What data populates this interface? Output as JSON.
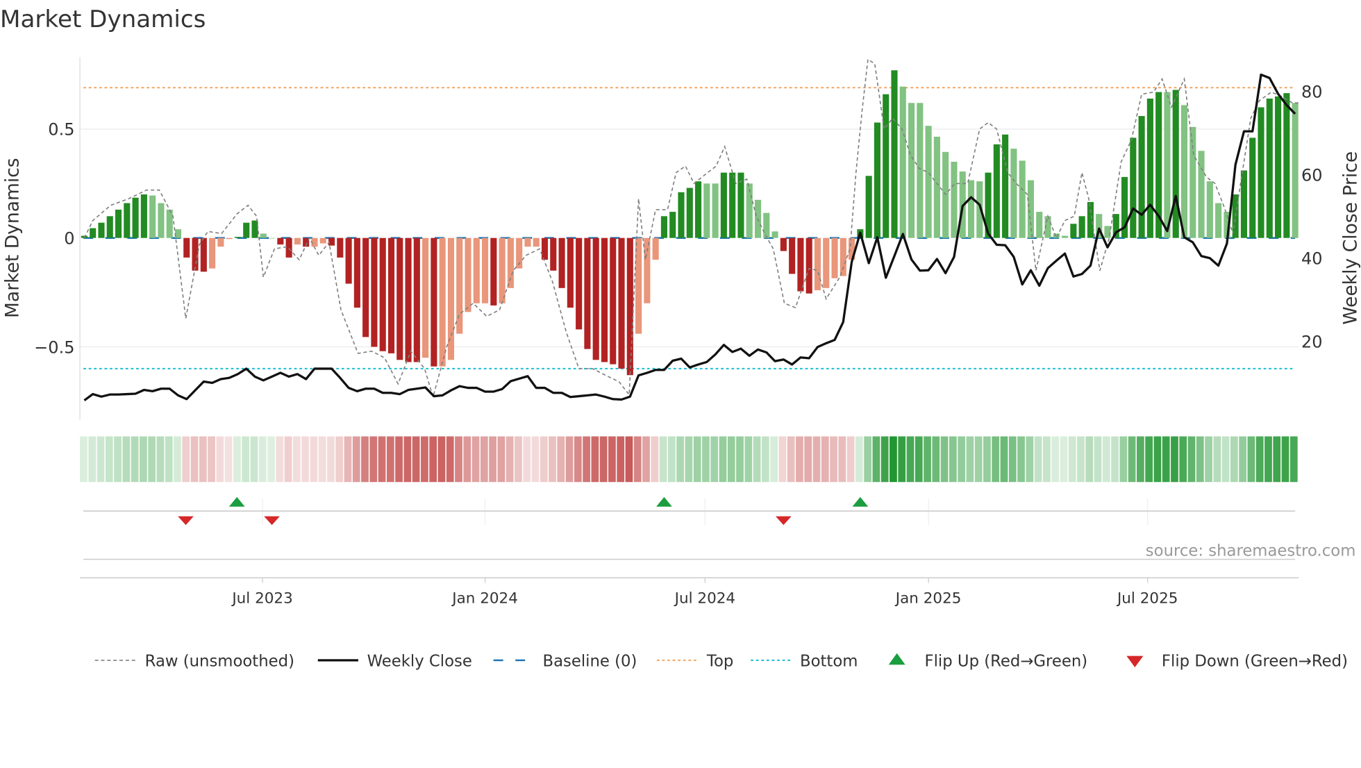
{
  "chart_data": {
    "type": "bar",
    "title": "Market Dynamics",
    "ylabel": "Market Dynamics",
    "y2label": "Weekly Close Price",
    "ylim": [
      -0.78,
      0.82
    ],
    "y2lim": [
      1,
      88
    ],
    "yticks": [
      {
        "v": 0.5,
        "label": "0.5"
      },
      {
        "v": 0,
        "label": "0"
      },
      {
        "v": -0.5,
        "label": "−0.5"
      }
    ],
    "y2ticks": [
      {
        "v": 80,
        "label": "80"
      },
      {
        "v": 60,
        "label": "60"
      },
      {
        "v": 40,
        "label": "40"
      },
      {
        "v": 20,
        "label": "20"
      }
    ],
    "x_unit": "week index",
    "xticks": [
      {
        "w": 20.9,
        "label": "Jul 2023"
      },
      {
        "w": 47,
        "label": "Jan 2024"
      },
      {
        "w": 72.8,
        "label": "Jul 2024"
      },
      {
        "w": 99,
        "label": "Jan 2025"
      },
      {
        "w": 124.7,
        "label": "Jul 2025"
      }
    ],
    "levels": {
      "top": 0.69,
      "bottom": -0.6,
      "baseline": 0
    },
    "colors": {
      "strong_up": "#228b22",
      "weak_up": "#82c282",
      "strong_down": "#b22222",
      "weak_down": "#e9967a",
      "baseline": "#1f77b4",
      "top": "#f4a460",
      "bottom": "#17becf",
      "close": "#111111",
      "raw": "#808080",
      "flip_up": "#1a9e3f",
      "flip_down": "#d62728"
    },
    "bars": [
      [
        0.01,
        1
      ],
      [
        0.045,
        1
      ],
      [
        0.07,
        1
      ],
      [
        0.1,
        1
      ],
      [
        0.13,
        1
      ],
      [
        0.16,
        1
      ],
      [
        0.185,
        1
      ],
      [
        0.2,
        1
      ],
      [
        0.195,
        0
      ],
      [
        0.16,
        0
      ],
      [
        0.13,
        0
      ],
      [
        0.04,
        0
      ],
      [
        -0.09,
        1
      ],
      [
        -0.15,
        1
      ],
      [
        -0.155,
        1
      ],
      [
        -0.14,
        0
      ],
      [
        -0.04,
        0
      ],
      [
        -0.005,
        0
      ],
      [
        0.005,
        1
      ],
      [
        0.07,
        1
      ],
      [
        0.08,
        1
      ],
      [
        0.02,
        0
      ],
      [
        0,
        0
      ],
      [
        -0.03,
        1
      ],
      [
        -0.09,
        1
      ],
      [
        -0.03,
        0
      ],
      [
        -0.04,
        1
      ],
      [
        -0.04,
        0
      ],
      [
        -0.025,
        0
      ],
      [
        -0.035,
        1
      ],
      [
        -0.09,
        1
      ],
      [
        -0.21,
        1
      ],
      [
        -0.32,
        1
      ],
      [
        -0.455,
        1
      ],
      [
        -0.5,
        1
      ],
      [
        -0.52,
        1
      ],
      [
        -0.53,
        1
      ],
      [
        -0.56,
        1
      ],
      [
        -0.57,
        1
      ],
      [
        -0.57,
        1
      ],
      [
        -0.55,
        0
      ],
      [
        -0.59,
        1
      ],
      [
        -0.59,
        0
      ],
      [
        -0.56,
        0
      ],
      [
        -0.44,
        0
      ],
      [
        -0.34,
        0
      ],
      [
        -0.3,
        0
      ],
      [
        -0.3,
        0
      ],
      [
        -0.31,
        1
      ],
      [
        -0.3,
        0
      ],
      [
        -0.23,
        0
      ],
      [
        -0.14,
        0
      ],
      [
        -0.04,
        0
      ],
      [
        -0.04,
        0
      ],
      [
        -0.1,
        1
      ],
      [
        -0.15,
        1
      ],
      [
        -0.23,
        1
      ],
      [
        -0.32,
        1
      ],
      [
        -0.42,
        1
      ],
      [
        -0.51,
        1
      ],
      [
        -0.56,
        1
      ],
      [
        -0.57,
        1
      ],
      [
        -0.58,
        1
      ],
      [
        -0.6,
        1
      ],
      [
        -0.63,
        1
      ],
      [
        -0.44,
        0
      ],
      [
        -0.3,
        0
      ],
      [
        -0.1,
        0
      ],
      [
        0.1,
        1
      ],
      [
        0.12,
        1
      ],
      [
        0.21,
        1
      ],
      [
        0.23,
        1
      ],
      [
        0.26,
        1
      ],
      [
        0.25,
        0
      ],
      [
        0.25,
        0
      ],
      [
        0.3,
        1
      ],
      [
        0.3,
        1
      ],
      [
        0.3,
        1
      ],
      [
        0.25,
        0
      ],
      [
        0.175,
        0
      ],
      [
        0.115,
        0
      ],
      [
        0.03,
        0
      ],
      [
        -0.06,
        1
      ],
      [
        -0.165,
        1
      ],
      [
        -0.245,
        1
      ],
      [
        -0.255,
        1
      ],
      [
        -0.24,
        0
      ],
      [
        -0.23,
        0
      ],
      [
        -0.185,
        0
      ],
      [
        -0.175,
        0
      ],
      [
        -0.1,
        0
      ],
      [
        0.04,
        1
      ],
      [
        0.285,
        1
      ],
      [
        0.53,
        1
      ],
      [
        0.66,
        1
      ],
      [
        0.77,
        1
      ],
      [
        0.695,
        0
      ],
      [
        0.62,
        0
      ],
      [
        0.62,
        0
      ],
      [
        0.515,
        0
      ],
      [
        0.465,
        0
      ],
      [
        0.395,
        0
      ],
      [
        0.35,
        0
      ],
      [
        0.305,
        0
      ],
      [
        0.265,
        0
      ],
      [
        0.26,
        0
      ],
      [
        0.3,
        1
      ],
      [
        0.43,
        1
      ],
      [
        0.475,
        1
      ],
      [
        0.41,
        0
      ],
      [
        0.355,
        0
      ],
      [
        0.265,
        0
      ],
      [
        0.12,
        0
      ],
      [
        0.1,
        0
      ],
      [
        0.02,
        0
      ],
      [
        0.01,
        0
      ],
      [
        0.065,
        1
      ],
      [
        0.1,
        1
      ],
      [
        0.165,
        1
      ],
      [
        0.11,
        0
      ],
      [
        0.055,
        0
      ],
      [
        0.11,
        1
      ],
      [
        0.28,
        1
      ],
      [
        0.46,
        1
      ],
      [
        0.56,
        1
      ],
      [
        0.64,
        1
      ],
      [
        0.67,
        1
      ],
      [
        0.67,
        0
      ],
      [
        0.68,
        1
      ],
      [
        0.61,
        0
      ],
      [
        0.51,
        0
      ],
      [
        0.4,
        0
      ],
      [
        0.26,
        0
      ],
      [
        0.16,
        0
      ],
      [
        0.12,
        0
      ],
      [
        0.2,
        1
      ],
      [
        0.31,
        1
      ],
      [
        0.46,
        1
      ],
      [
        0.6,
        1
      ],
      [
        0.64,
        1
      ],
      [
        0.65,
        1
      ],
      [
        0.665,
        1
      ],
      [
        0.62,
        0
      ]
    ],
    "weekly_close": [
      5.9,
      7.4,
      6.8,
      7.3,
      7.3,
      7.4,
      7.5,
      8.4,
      8.1,
      8.7,
      8.7,
      7.1,
      6.2,
      8.3,
      10.4,
      10.1,
      11,
      11.3,
      12.2,
      13.5,
      11.6,
      10.7,
      11.6,
      12.5,
      11.6,
      12.2,
      11,
      13.5,
      13.5,
      13.5,
      11.3,
      8.9,
      8.1,
      8.7,
      8.7,
      7.7,
      7.7,
      7.4,
      8.4,
      8.7,
      9,
      6.9,
      7.1,
      8.3,
      9.3,
      8.9,
      8.9,
      8,
      8,
      8.6,
      10.5,
      11.1,
      11.7,
      8.9,
      8.9,
      7.7,
      7.7,
      6.7,
      6.9,
      7.1,
      7.3,
      6.8,
      6.2,
      6.1,
      6.8,
      11.9,
      12.5,
      13.2,
      13.2,
      15.4,
      15.9,
      13.8,
      14.5,
      15.1,
      16.9,
      19.2,
      17.5,
      18.3,
      16.6,
      18.1,
      17.4,
      15.3,
      15.7,
      14.5,
      16.2,
      16,
      18.7,
      19.6,
      20.4,
      24.7,
      39.1,
      46.1,
      38.8,
      45,
      35.3,
      40.5,
      45.8,
      39.7,
      37,
      37.1,
      39.8,
      36.4,
      40.3,
      52.5,
      54.6,
      52.8,
      45.9,
      43.2,
      43.1,
      40.3,
      33.7,
      37.1,
      33.4,
      37.6,
      39.4,
      41.1,
      35.6,
      36.2,
      38.2,
      47.1,
      42.6,
      46.2,
      47.4,
      51.9,
      50.4,
      52.8,
      50.1,
      46.5,
      54.9,
      45,
      43.8,
      40.5,
      40,
      38.2,
      43.5,
      62.4,
      70.4,
      70.4,
      84,
      83.2,
      79.4,
      76.7,
      74.6
    ],
    "raw": [
      [
        0,
        0
      ],
      [
        1,
        0.08
      ],
      [
        3.1,
        0.15
      ],
      [
        5.2,
        0.18
      ],
      [
        7.3,
        0.22
      ],
      [
        8.8,
        0.22
      ],
      [
        10.4,
        0.1
      ],
      [
        11.9,
        -0.37
      ],
      [
        13.5,
        -0.03
      ],
      [
        14.5,
        0.03
      ],
      [
        16.1,
        0.02
      ],
      [
        17.9,
        0.11
      ],
      [
        19.2,
        0.15
      ],
      [
        20.2,
        0.1
      ],
      [
        21,
        -0.18
      ],
      [
        22.3,
        -0.05
      ],
      [
        23.8,
        -0.04
      ],
      [
        25.2,
        -0.1
      ],
      [
        26.4,
        0
      ],
      [
        27.5,
        -0.08
      ],
      [
        28.7,
        -0.02
      ],
      [
        30.1,
        -0.33
      ],
      [
        32.1,
        -0.53
      ],
      [
        33.7,
        -0.52
      ],
      [
        35.2,
        -0.55
      ],
      [
        36.8,
        -0.67
      ],
      [
        38.3,
        -0.52
      ],
      [
        39.9,
        -0.6
      ],
      [
        40.9,
        -0.73
      ],
      [
        42.5,
        -0.5
      ],
      [
        44,
        -0.35
      ],
      [
        45.6,
        -0.3
      ],
      [
        47.2,
        -0.36
      ],
      [
        48.7,
        -0.33
      ],
      [
        50.3,
        -0.15
      ],
      [
        51.8,
        -0.08
      ],
      [
        53.4,
        -0.05
      ],
      [
        54.9,
        -0.2
      ],
      [
        56.5,
        -0.43
      ],
      [
        58,
        -0.6
      ],
      [
        59.6,
        -0.6
      ],
      [
        61.1,
        -0.63
      ],
      [
        62.7,
        -0.66
      ],
      [
        63.9,
        -0.72
      ],
      [
        65,
        0.18
      ],
      [
        65.8,
        -0.1
      ],
      [
        67,
        0.13
      ],
      [
        68.4,
        0.13
      ],
      [
        69.4,
        0.3
      ],
      [
        70.5,
        0.33
      ],
      [
        71.5,
        0.25
      ],
      [
        73.1,
        0.3
      ],
      [
        74.1,
        0.33
      ],
      [
        75.1,
        0.42
      ],
      [
        76.4,
        0.25
      ],
      [
        77.7,
        0.27
      ],
      [
        78.8,
        0.1
      ],
      [
        79.8,
        0.02
      ],
      [
        80.8,
        -0.05
      ],
      [
        82.1,
        -0.3
      ],
      [
        83.4,
        -0.32
      ],
      [
        85,
        -0.14
      ],
      [
        86,
        -0.15
      ],
      [
        87,
        -0.28
      ],
      [
        88.6,
        -0.18
      ],
      [
        89.8,
        -0.05
      ],
      [
        90.5,
        0.3
      ],
      [
        91.2,
        0.58
      ],
      [
        91.9,
        0.82
      ],
      [
        92.7,
        0.8
      ],
      [
        93.8,
        0.5
      ],
      [
        94.8,
        0.55
      ],
      [
        95.9,
        0.5
      ],
      [
        96.9,
        0.38
      ],
      [
        97.9,
        0.32
      ],
      [
        99,
        0.3
      ],
      [
        100,
        0.25
      ],
      [
        101,
        0.2
      ],
      [
        102.1,
        0.25
      ],
      [
        103.6,
        0.25
      ],
      [
        105,
        0.5
      ],
      [
        106,
        0.53
      ],
      [
        107,
        0.5
      ],
      [
        108.3,
        0.3
      ],
      [
        109.3,
        0.25
      ],
      [
        110.6,
        0.2
      ],
      [
        111.6,
        -0.15
      ],
      [
        113,
        0.1
      ],
      [
        114,
        0
      ],
      [
        115,
        0.08
      ],
      [
        116.1,
        0.1
      ],
      [
        117,
        0.3
      ],
      [
        117.8,
        0.18
      ],
      [
        119.1,
        -0.15
      ],
      [
        120.2,
        0
      ],
      [
        121.6,
        0.35
      ],
      [
        122.8,
        0.45
      ],
      [
        124,
        0.66
      ],
      [
        125.4,
        0.67
      ],
      [
        126.4,
        0.73
      ],
      [
        127.5,
        0.6
      ],
      [
        129,
        0.73
      ],
      [
        130.1,
        0.38
      ],
      [
        131.6,
        0.28
      ],
      [
        132.6,
        0.25
      ],
      [
        133.7,
        0.14
      ],
      [
        134.7,
        0.02
      ],
      [
        135.8,
        0.3
      ],
      [
        136.8,
        0.55
      ],
      [
        137.8,
        0.63
      ],
      [
        139.2,
        0.67
      ],
      [
        140.4,
        0.65
      ],
      [
        141.7,
        0.62
      ],
      [
        142.7,
        0.62
      ]
    ],
    "flips_up": [
      17.9,
      68,
      91
    ],
    "flips_down": [
      11.9,
      22,
      82
    ],
    "legend": [
      "Raw (unsmoothed)",
      "Weekly Close",
      "Baseline (0)",
      "Top",
      "Bottom",
      "Flip Up (Red→Green)",
      "Flip Down (Green→Red)"
    ],
    "legend_position": "bottom",
    "source": "source: sharemaestro.com"
  }
}
